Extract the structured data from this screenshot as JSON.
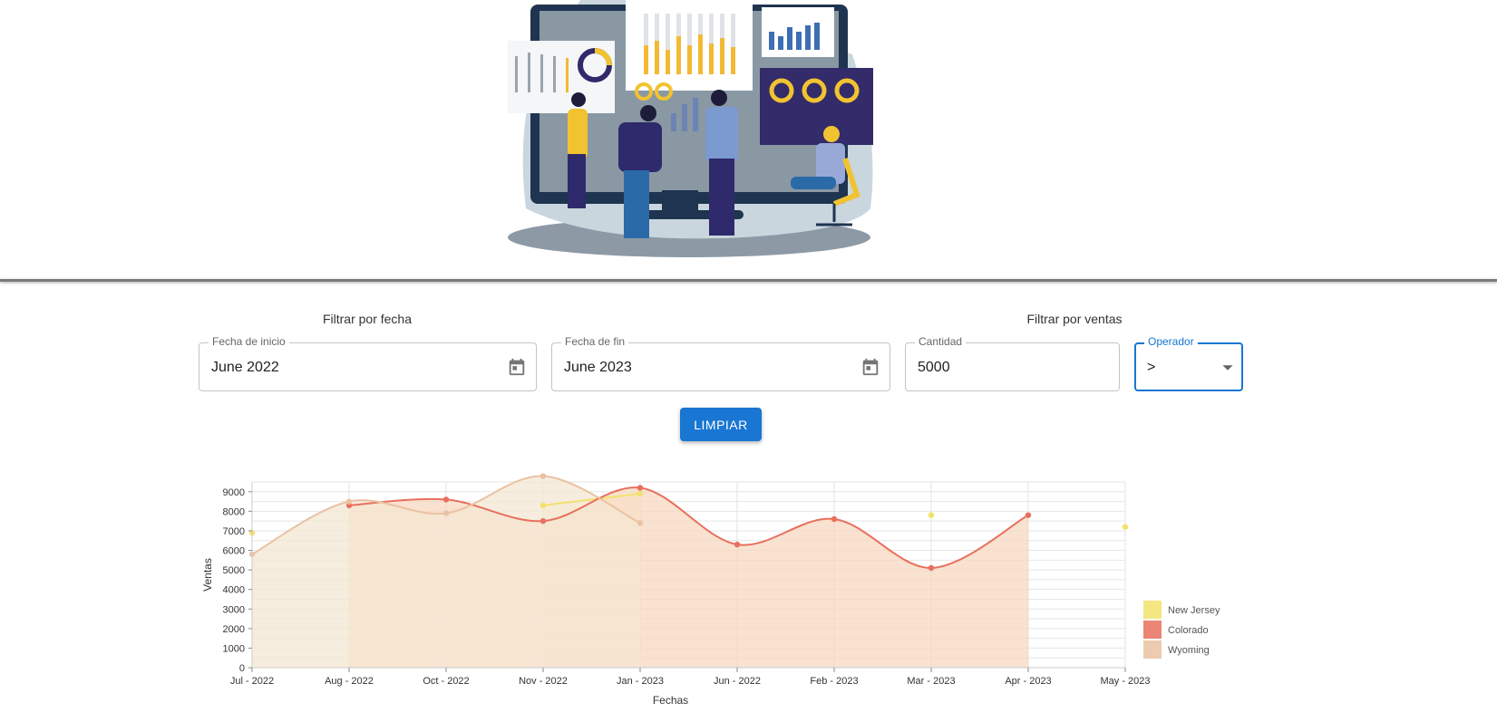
{
  "filters": {
    "date_title": "Filtrar por fecha",
    "sales_title": "Filtrar por ventas",
    "start": {
      "label": "Fecha de inicio",
      "value": "June 2022"
    },
    "end": {
      "label": "Fecha de fin",
      "value": "June 2023"
    },
    "quantity": {
      "label": "Cantidad",
      "value": "5000"
    },
    "operator": {
      "label": "Operador",
      "value": ">"
    },
    "clear_label": "LIMPIAR"
  },
  "chart_data": {
    "type": "area",
    "xlabel": "Fechas",
    "ylabel": "Ventas",
    "categories": [
      "Jul - 2022",
      "Aug - 2022",
      "Oct - 2022",
      "Nov - 2022",
      "Jan - 2023",
      "Jun - 2022",
      "Feb - 2023",
      "Mar - 2023",
      "Apr - 2023",
      "May - 2023"
    ],
    "ylim": [
      0,
      9500
    ],
    "yticks": [
      0,
      1000,
      2000,
      3000,
      4000,
      5000,
      6000,
      7000,
      8000,
      9000
    ],
    "grid": true,
    "legend_position": "right",
    "series": [
      {
        "name": "New Jersey",
        "color": "#f2e26b",
        "fill": "#fdf6dc",
        "values": [
          6900,
          null,
          null,
          8300,
          8900,
          null,
          null,
          7800,
          null,
          7200
        ]
      },
      {
        "name": "Colorado",
        "color": "#e8705e",
        "fill": "#f7d8c0",
        "values": [
          null,
          8300,
          8600,
          7500,
          9200,
          6300,
          7600,
          5100,
          7800,
          null
        ]
      },
      {
        "name": "Wyoming",
        "color": "#e9c2a3",
        "fill": "#f4e7d3",
        "values": [
          5800,
          8500,
          7900,
          9800,
          7400,
          null,
          null,
          null,
          null,
          null
        ]
      }
    ]
  }
}
